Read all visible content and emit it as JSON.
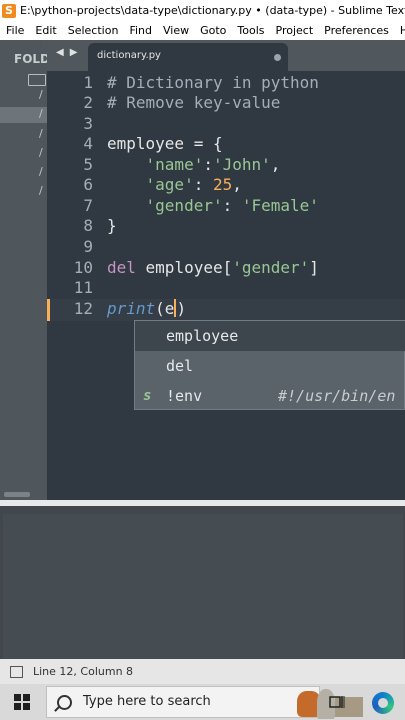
{
  "window": {
    "title": "E:\\python-projects\\data-type\\dictionary.py • (data-type) - Sublime Text (UNR"
  },
  "menu": [
    "File",
    "Edit",
    "Selection",
    "Find",
    "View",
    "Goto",
    "Tools",
    "Project",
    "Preferences",
    "He"
  ],
  "sidebar": {
    "label": "FOLD",
    "items": [
      "/",
      "/",
      "/",
      "/",
      "/",
      "/"
    ]
  },
  "tab": {
    "filename": "dictionary.py"
  },
  "gutter": [
    "1",
    "2",
    "3",
    "4",
    "5",
    "6",
    "7",
    "8",
    "9",
    "10",
    "11",
    "12"
  ],
  "code": {
    "l1": "# Dictionary in python",
    "l2": "# Remove key-value",
    "l4a": "employee = {",
    "l5_indent": "    ",
    "l5_key": "'name'",
    "l5_colon": ":",
    "l5_val": "'John'",
    "l5_comma": ",",
    "l6_key": "'age'",
    "l6_colon": ": ",
    "l6_val": "25",
    "l6_comma": ",",
    "l7_key": "'gender'",
    "l7_colon": ": ",
    "l7_val": "'Female'",
    "l8": "}",
    "l10_kw": "del",
    "l10_a": " employee[",
    "l10_str": "'gender'",
    "l10_b": "]",
    "l12_fn": "print",
    "l12_a": "(e",
    "l12_b": ")"
  },
  "autocomplete": {
    "items": [
      {
        "text": "employee",
        "kind": "",
        "hint": ""
      },
      {
        "text": "del",
        "kind": "",
        "hint": ""
      },
      {
        "text": "!env",
        "kind": "s",
        "hint": "#!/usr/bin/en"
      }
    ]
  },
  "status": {
    "text": "Line 12, Column 8"
  },
  "taskbar": {
    "search_placeholder": "Type here to search"
  },
  "colors": {
    "editor_bg": "#303841",
    "sidebar_bg": "#4f565c",
    "string": "#99c794",
    "number": "#f9ae58",
    "keyword": "#c594c5",
    "function": "#6699cc"
  }
}
